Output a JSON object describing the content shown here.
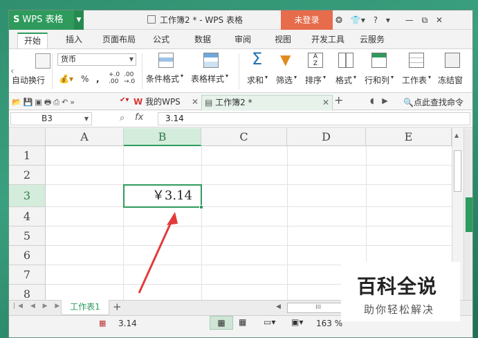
{
  "app": {
    "name": "WPS 表格",
    "doc_title": "工作簿2 * - WPS 表格",
    "login_label": "未登录",
    "help_label": "?"
  },
  "menu_tabs": [
    "开始",
    "插入",
    "页面布局",
    "公式",
    "数据",
    "审阅",
    "视图",
    "开发工具",
    "云服务"
  ],
  "ribbon": {
    "wrap_label": "自动换行",
    "number_format": "货币",
    "percent": "%",
    "comma": ",",
    "dec_inc": "+.0 .00",
    "dec_dec": ".00 →.0",
    "cond_format": "条件格式",
    "table_style": "表格样式",
    "sum": "求和",
    "filter": "筛选",
    "sort": "排序",
    "format": "格式",
    "row_col": "行和列",
    "sheet": "工作表",
    "freeze": "冻结窗"
  },
  "doc_tabs": {
    "my_wps": "我的WPS",
    "workbook": "工作簿2 *",
    "add": "+",
    "search": "点此查找命令"
  },
  "formula_bar": {
    "cell_ref": "B3",
    "fx": "fx",
    "value": "3.14"
  },
  "grid": {
    "columns": [
      "A",
      "B",
      "C",
      "D",
      "E"
    ],
    "rows": [
      "1",
      "2",
      "3",
      "4",
      "5",
      "6",
      "7",
      "8"
    ],
    "selected_column": "B",
    "selected_row": "3",
    "active_value": "￥3.14"
  },
  "sheets": {
    "active": "工作表1",
    "add": "+"
  },
  "status": {
    "value": "3.14",
    "zoom": "163 %"
  },
  "watermark": {
    "line1": "百科全说",
    "line2": "助你轻松解决"
  },
  "colors": {
    "accent": "#2e9a5c",
    "login": "#e66c4c",
    "arrow": "#e23b3b"
  }
}
